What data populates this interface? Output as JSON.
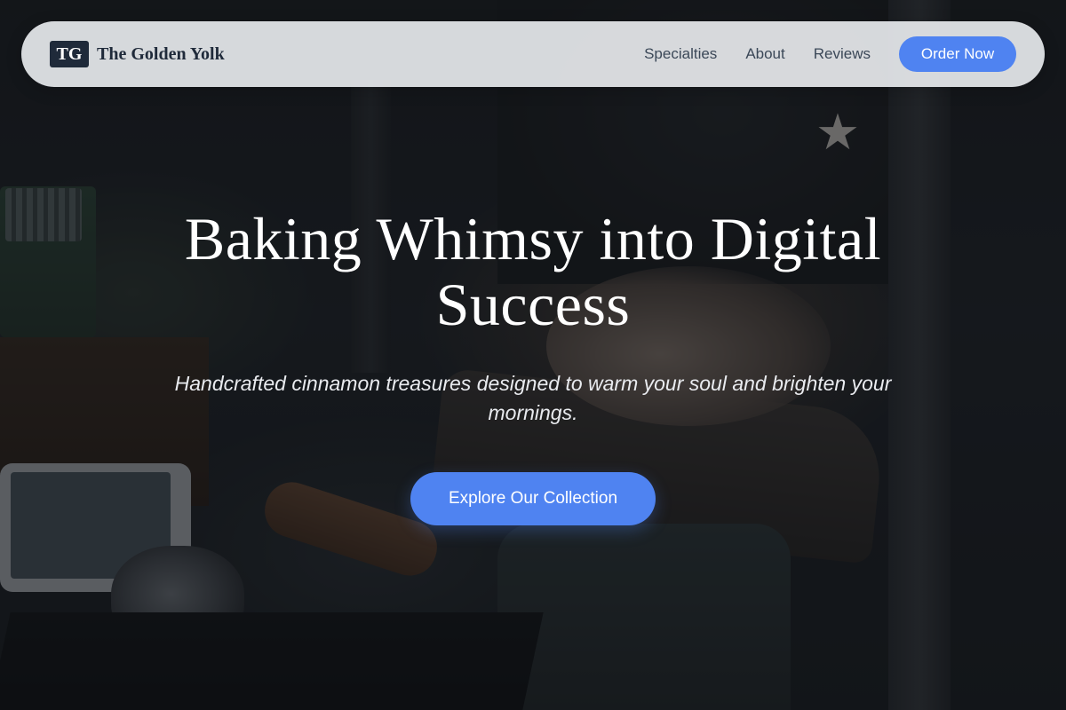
{
  "brand": {
    "badge": "TG",
    "name": "The Golden Yolk"
  },
  "nav": {
    "links": [
      "Specialties",
      "About",
      "Reviews"
    ],
    "cta_label": "Order Now"
  },
  "hero": {
    "title": "Baking Whimsy into Digital Success",
    "subtitle": "Handcrafted cinnamon treasures designed to warm your soul and brighten your mornings.",
    "cta_label": "Explore Our Collection",
    "background_image": "dim workbench photo: hands over anvil, stamp set, tablet, tools"
  },
  "colors": {
    "accent": "#4f83f1",
    "brand_dark": "#1f2a3a",
    "nav_text": "#3b4858"
  }
}
